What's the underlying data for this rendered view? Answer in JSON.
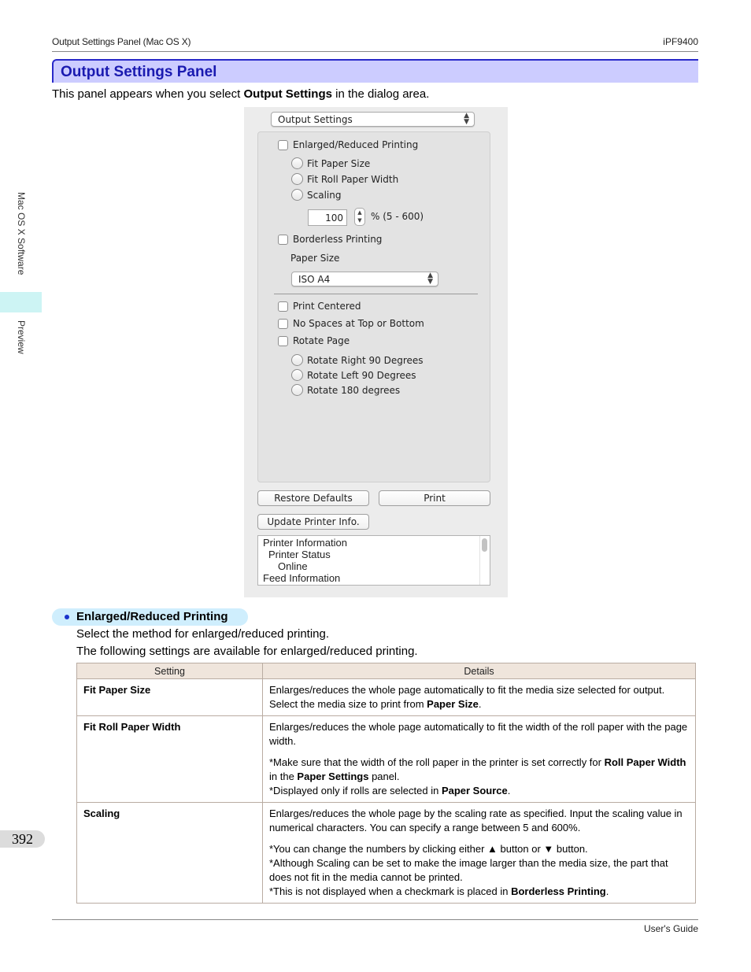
{
  "header": {
    "section": "Output Settings Panel (Mac OS X)",
    "model": "iPF9400"
  },
  "page_title": "Output Settings Panel",
  "intro": {
    "before": "This panel appears when you select ",
    "bold": "Output Settings",
    "after": " in the dialog area."
  },
  "side_tabs": {
    "chapter": "Mac OS X Software",
    "section": "Preview"
  },
  "dialog": {
    "panel_popup": "Output Settings",
    "enlarged_reduced_printing": {
      "label": "Enlarged/Reduced Printing",
      "checked": false
    },
    "scaling_options": [
      {
        "label": "Fit Paper Size",
        "selected": false
      },
      {
        "label": "Fit Roll Paper Width",
        "selected": false
      },
      {
        "label": "Scaling",
        "selected": false
      }
    ],
    "scaling_value": "100",
    "scaling_range": "% (5 - 600)",
    "borderless_printing": {
      "label": "Borderless Printing",
      "checked": false
    },
    "paper_size_label": "Paper Size",
    "paper_size_value": "ISO A4",
    "print_centered": {
      "label": "Print Centered",
      "checked": false
    },
    "no_spaces": {
      "label": "No Spaces at Top or Bottom",
      "checked": false
    },
    "rotate_page": {
      "label": "Rotate Page",
      "checked": false
    },
    "rotate_options": [
      {
        "label": "Rotate Right 90 Degrees",
        "selected": false
      },
      {
        "label": "Rotate Left 90 Degrees",
        "selected": false
      },
      {
        "label": "Rotate 180 degrees",
        "selected": false
      }
    ],
    "buttons": {
      "restore_defaults": "Restore Defaults",
      "print": "Print",
      "update_printer_info": "Update Printer Info."
    },
    "printer_info_lines": [
      "Printer Information",
      "Printer Status",
      "Online",
      "Feed Information"
    ]
  },
  "subsection": {
    "title": "Enlarged/Reduced Printing",
    "line1": "Select the method for enlarged/reduced printing.",
    "line2": "The following settings are available for enlarged/reduced printing."
  },
  "table": {
    "headers": [
      "Setting",
      "Details"
    ],
    "rows": [
      {
        "setting": "Fit Paper Size",
        "p1": {
          "a": "Enlarges/reduces the whole page automatically to fit the media size selected for output. Select the media size to print from ",
          "b": "Paper Size",
          "c": "."
        }
      },
      {
        "setting": "Fit Roll Paper Width",
        "p1": "Enlarges/reduces the whole page automatically to fit the width of the roll paper with the page width.",
        "p2": {
          "a": "*Make sure that the width of the roll paper in the printer is set correctly for ",
          "b": "Roll Paper Width",
          "c": " in the ",
          "d": "Paper Settings",
          "e": " panel."
        },
        "p3": {
          "a": "*Displayed only if rolls are selected in ",
          "b": "Paper Source",
          "c": "."
        }
      },
      {
        "setting": "Scaling",
        "p1": "Enlarges/reduces the whole page by the scaling rate as specified. Input the scaling value in numerical characters. You can specify a range between 5 and 600%.",
        "p2": "*You can change the numbers by clicking either ▲ button or ▼ button.",
        "p3": "*Although Scaling can be set to make the image larger than the media size, the part that does not fit in the media cannot be printed.",
        "p4": {
          "a": "*This is not displayed when a checkmark is placed in ",
          "b": "Borderless Printing",
          "c": "."
        }
      }
    ]
  },
  "page_number": "392",
  "footer": {
    "guide": "User's Guide"
  }
}
